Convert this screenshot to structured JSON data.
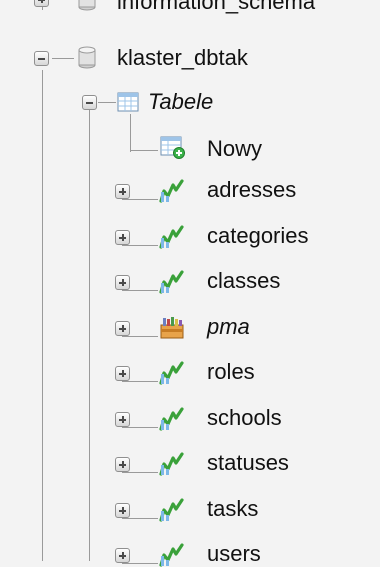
{
  "tree": {
    "partial_db": {
      "label": "information_schema",
      "icon": "database-icon"
    },
    "database": {
      "label": "klaster_dbtak",
      "icon": "database-icon"
    },
    "group": {
      "label": "Tabele",
      "icon": "table-group-icon"
    },
    "new_item": {
      "label": "Nowy",
      "icon": "new-table-icon"
    },
    "tables": [
      {
        "name": "adresses",
        "icon": "table-icon"
      },
      {
        "name": "categories",
        "icon": "table-icon"
      },
      {
        "name": "classes",
        "icon": "table-icon"
      },
      {
        "name": "pma",
        "icon": "pma-icon",
        "italic": true
      },
      {
        "name": "roles",
        "icon": "table-icon"
      },
      {
        "name": "schools",
        "icon": "table-icon"
      },
      {
        "name": "statuses",
        "icon": "table-icon"
      },
      {
        "name": "tasks",
        "icon": "table-icon"
      },
      {
        "name": "users",
        "icon": "table-icon"
      }
    ]
  }
}
